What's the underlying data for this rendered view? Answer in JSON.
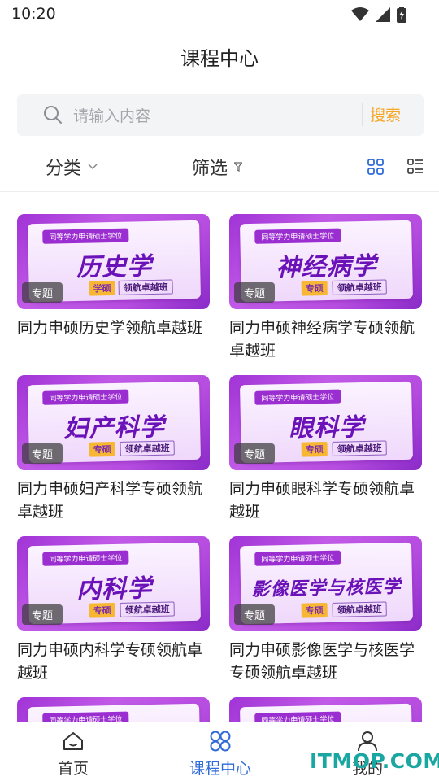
{
  "status_bar": {
    "time": "10:20"
  },
  "header": {
    "title": "课程中心"
  },
  "search": {
    "placeholder": "请输入内容",
    "button_label": "搜索"
  },
  "filters": {
    "category_label": "分类",
    "filter_label": "筛选"
  },
  "courses": [
    {
      "banner_top": "同等学力申请硕士学位",
      "subject": "历史学",
      "badge": "学硕",
      "line": "领航卓越班",
      "tag": "专题",
      "title": "同力申硕历史学领航卓越班"
    },
    {
      "banner_top": "同等学力申请硕士学位",
      "subject": "神经病学",
      "badge": "专硕",
      "line": "领航卓越班",
      "tag": "专题",
      "title": "同力申硕神经病学专硕领航卓越班"
    },
    {
      "banner_top": "同等学力申请硕士学位",
      "subject": "妇产科学",
      "badge": "专硕",
      "line": "领航卓越班",
      "tag": "专题",
      "title": "同力申硕妇产科学专硕领航卓越班"
    },
    {
      "banner_top": "同等学力申请硕士学位",
      "subject": "眼科学",
      "badge": "专硕",
      "line": "领航卓越班",
      "tag": "专题",
      "title": "同力申硕眼科学专硕领航卓越班"
    },
    {
      "banner_top": "同等学力申请硕士学位",
      "subject": "内科学",
      "badge": "专硕",
      "line": "领航卓越班",
      "tag": "专题",
      "title": "同力申硕内科学专硕领航卓越班"
    },
    {
      "banner_top": "同等学力申请硕士学位",
      "subject": "影像医学与核医学",
      "badge": "专硕",
      "line": "领航卓越班",
      "tag": "专题",
      "title": "同力申硕影像医学与核医学专硕领航卓越班"
    },
    {
      "banner_top": "同等学力申请硕士学位"
    },
    {
      "banner_top": "同等学力申请硕士学位"
    }
  ],
  "tabbar": {
    "home": "首页",
    "course_center": "课程中心",
    "mine": "我的"
  },
  "watermark": "ITMOP.COM",
  "colors": {
    "accent": "#2f6bd8",
    "search_button": "#f5a623",
    "thumb_purple": "#a033d6"
  },
  "icons": [
    "wifi-icon",
    "signal-icon",
    "battery-icon",
    "search-icon",
    "chevron-down-icon",
    "filter-funnel-icon",
    "grid-view-icon",
    "list-view-icon",
    "home-icon",
    "course-center-icon",
    "user-icon"
  ]
}
